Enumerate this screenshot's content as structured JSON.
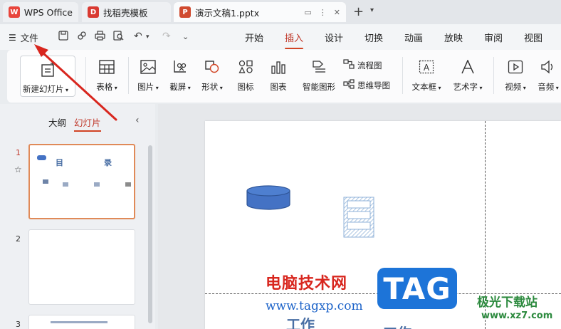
{
  "tabs": [
    {
      "label": "WPS Office",
      "logo": "W"
    },
    {
      "label": "找稻壳模板",
      "logo": "D"
    },
    {
      "label": "演示文稿1.pptx",
      "logo": "P"
    }
  ],
  "menu": {
    "file_label": "文件",
    "tabs": [
      "开始",
      "插入",
      "设计",
      "切换",
      "动画",
      "放映",
      "审阅",
      "视图"
    ],
    "active_tab": "插入"
  },
  "ribbon": {
    "new_slide": "新建幻灯片",
    "table": "表格",
    "picture": "图片",
    "screenshot": "截屏",
    "shape": "形状",
    "icon": "图标",
    "chart": "图表",
    "smartart": "智能图形",
    "flowchart": "流程图",
    "mindmap": "思维导图",
    "textbox": "文本框",
    "wordart": "艺术字",
    "video": "视频",
    "audio": "音频"
  },
  "panel": {
    "outline_tab": "大纲",
    "slides_tab": "幻灯片",
    "slide_numbers": [
      "1",
      "2",
      "3"
    ]
  },
  "thumb1": {
    "title_left": "目",
    "title_right": "录"
  },
  "slide": {
    "bottom_left": "工作",
    "bottom_right": "工作"
  },
  "watermark": {
    "title": "电脑技术网",
    "url": "www.tagxp.com",
    "tag": "TAG",
    "site_cn": "极光下载站",
    "site_url": "www.xz7.com"
  },
  "colors": {
    "accent": "#d14424",
    "brand_wps": "#e8453c",
    "brand_doc": "#d04a2f",
    "shape_blue": "#4472c4"
  }
}
